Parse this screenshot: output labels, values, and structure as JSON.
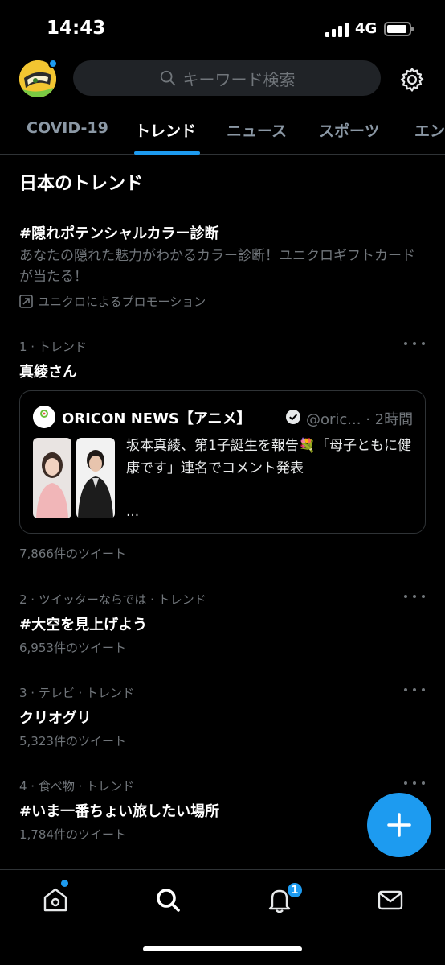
{
  "status_bar": {
    "time": "14:43",
    "network": "4G"
  },
  "header": {
    "search_placeholder": "キーワード検索"
  },
  "tabs": [
    {
      "label": "COVID-19"
    },
    {
      "label": "トレンド"
    },
    {
      "label": "ニュース"
    },
    {
      "label": "スポーツ"
    },
    {
      "label": "エン"
    }
  ],
  "section_title": "日本のトレンド",
  "promoted": {
    "title": "#隠れポテンシャルカラー診断",
    "description": "あなたの隠れた魅力がわかるカラー診断！ユニクロギフトカードが当たる！",
    "by": "ユニクロによるプロモーション"
  },
  "trends": [
    {
      "meta": "1 · トレンド",
      "name": "真綾さん",
      "count": "7,866件のツイート"
    },
    {
      "meta": "2 · ツイッターならでは · トレンド",
      "name": "#大空を見上げよう",
      "count": "6,953件のツイート"
    },
    {
      "meta": "3 · テレビ · トレンド",
      "name": "クリオグリ",
      "count": "5,323件のツイート"
    },
    {
      "meta": "4 · 食べ物 · トレンド",
      "name": "#いま一番ちょい旅したい場所",
      "count": "1,784件のツイート"
    }
  ],
  "news_card": {
    "source": "ORICON NEWS【アニメ】",
    "handle": "@oric... · 2時間",
    "logo_text": "アニメ",
    "text": "坂本真綾、第1子誕生を報告💐「母子ともに健康です」連名でコメント発表",
    "ellipsis": "..."
  },
  "bottom_nav": {
    "notification_count": "1"
  },
  "colors": {
    "accent": "#1d9bf0",
    "background": "#000000",
    "secondary_text": "#71767b"
  },
  "icons": [
    "search-icon",
    "gear-icon",
    "home-icon",
    "explore-icon",
    "notifications-icon",
    "messages-icon",
    "compose-icon",
    "verified-icon",
    "more-icon",
    "promoted-icon"
  ]
}
